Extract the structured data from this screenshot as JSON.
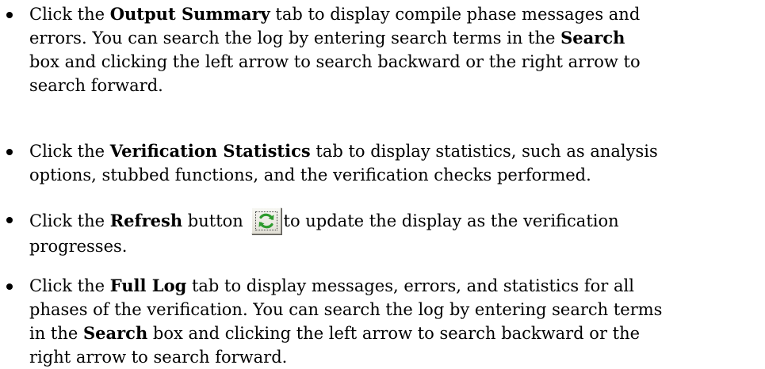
{
  "items": [
    {
      "lines": [
        {
          "pre": "Click the ",
          "bold": "Output Summary",
          "post": " tab to display compile phase messages and"
        },
        {
          "pre": "errors. You can search the log by entering search terms in the ",
          "bold": "Search",
          "post": ""
        },
        {
          "pre": "box and clicking the left arrow to search backward or the right arrow to",
          "bold": "",
          "post": ""
        },
        {
          "pre": "search forward.",
          "bold": "",
          "post": ""
        }
      ]
    },
    {
      "lines": [
        {
          "pre": "Click the ",
          "bold": "Verification Statistics",
          "post": " tab to display statistics, such as analysis"
        },
        {
          "pre": "options, stubbed functions, and the verification checks performed.",
          "bold": "",
          "post": ""
        }
      ]
    },
    {
      "line1_pre": "Click the ",
      "line1_bold": "Refresh",
      "line1_mid": " button",
      "line1_post": "to update the display as the verification",
      "line2": "progresses.",
      "button_icon": "refresh-icon"
    },
    {
      "lines": [
        {
          "pre": "Click the ",
          "bold": "Full Log",
          "post": " tab to display messages, errors, and statistics for all"
        },
        {
          "pre": "phases of the verification. You can search the log by entering search terms",
          "bold": "",
          "post": ""
        },
        {
          "pre": "in the ",
          "bold": "Search",
          "post": " box and clicking the left arrow to search backward or the"
        },
        {
          "pre": "right arrow to search forward.",
          "bold": "",
          "post": ""
        }
      ]
    }
  ],
  "colors": {
    "text": "#000000",
    "icon_green": "#2e9a2e",
    "button_face": "#ecebe3"
  }
}
